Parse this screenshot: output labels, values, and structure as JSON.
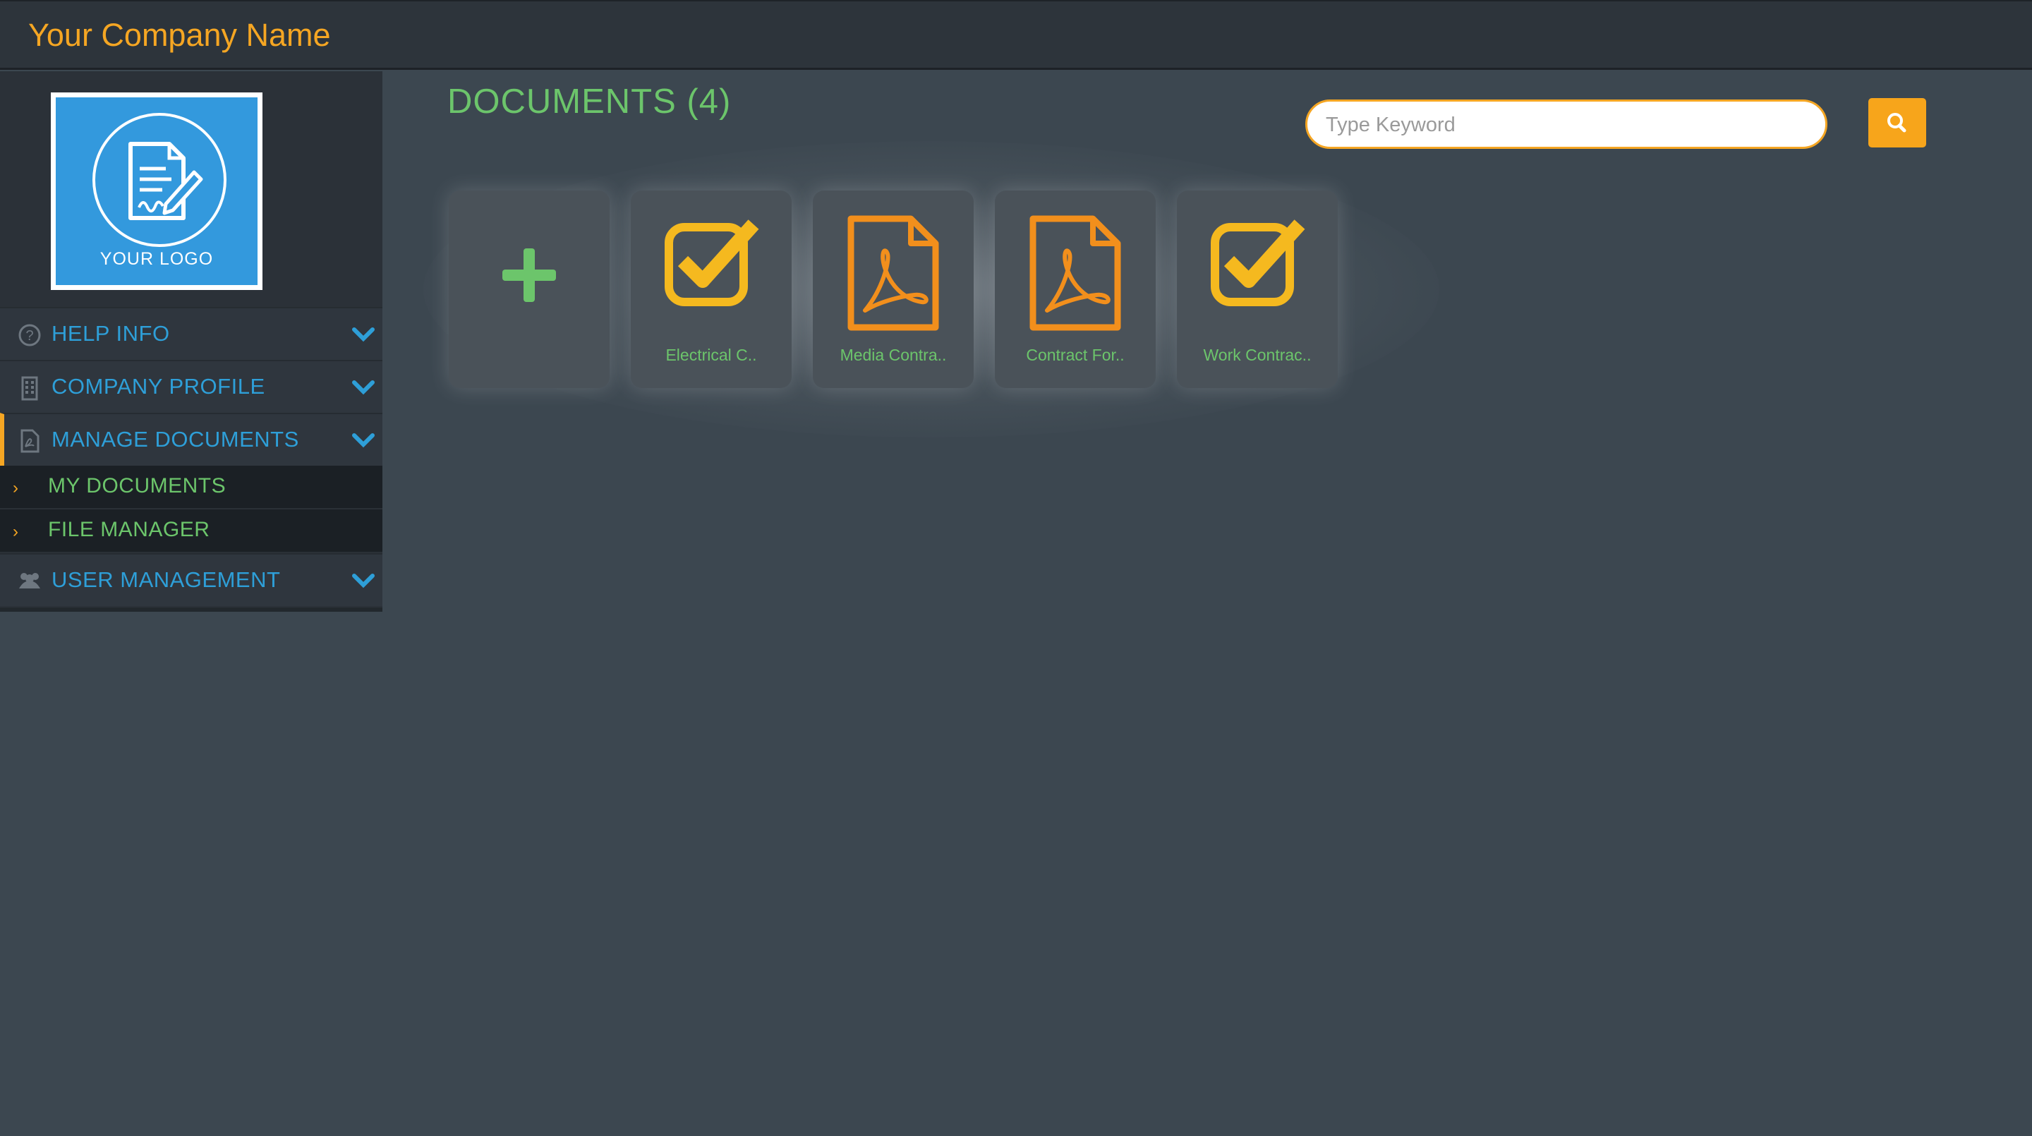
{
  "header": {
    "company_name": "Your Company Name"
  },
  "logo": {
    "text": "YOUR LOGO"
  },
  "sidebar": {
    "items": [
      {
        "label": "HELP INFO",
        "icon": "question-circle-icon"
      },
      {
        "label": "COMPANY PROFILE",
        "icon": "building-icon"
      },
      {
        "label": "MANAGE DOCUMENTS",
        "icon": "pdf-file-icon"
      },
      {
        "label": "USER MANAGEMENT",
        "icon": "users-icon"
      }
    ],
    "sub_items": [
      {
        "label": "MY DOCUMENTS"
      },
      {
        "label": "FILE MANAGER"
      }
    ]
  },
  "main": {
    "title": "DOCUMENTS (4)",
    "search": {
      "placeholder": "Type Keyword",
      "value": ""
    },
    "cards": [
      {
        "label": "",
        "icon": "add-plus-icon"
      },
      {
        "label": "Electrical C..",
        "icon": "checkbox-checked-icon"
      },
      {
        "label": "Media Contra..",
        "icon": "pdf-file-icon"
      },
      {
        "label": "Contract For..",
        "icon": "pdf-file-icon"
      },
      {
        "label": "Work Contrac..",
        "icon": "checkbox-checked-icon"
      }
    ]
  },
  "colors": {
    "accent": "#f5a623",
    "green": "#6cc56b",
    "blue": "#2e9fd8",
    "background": "#3c4750"
  }
}
